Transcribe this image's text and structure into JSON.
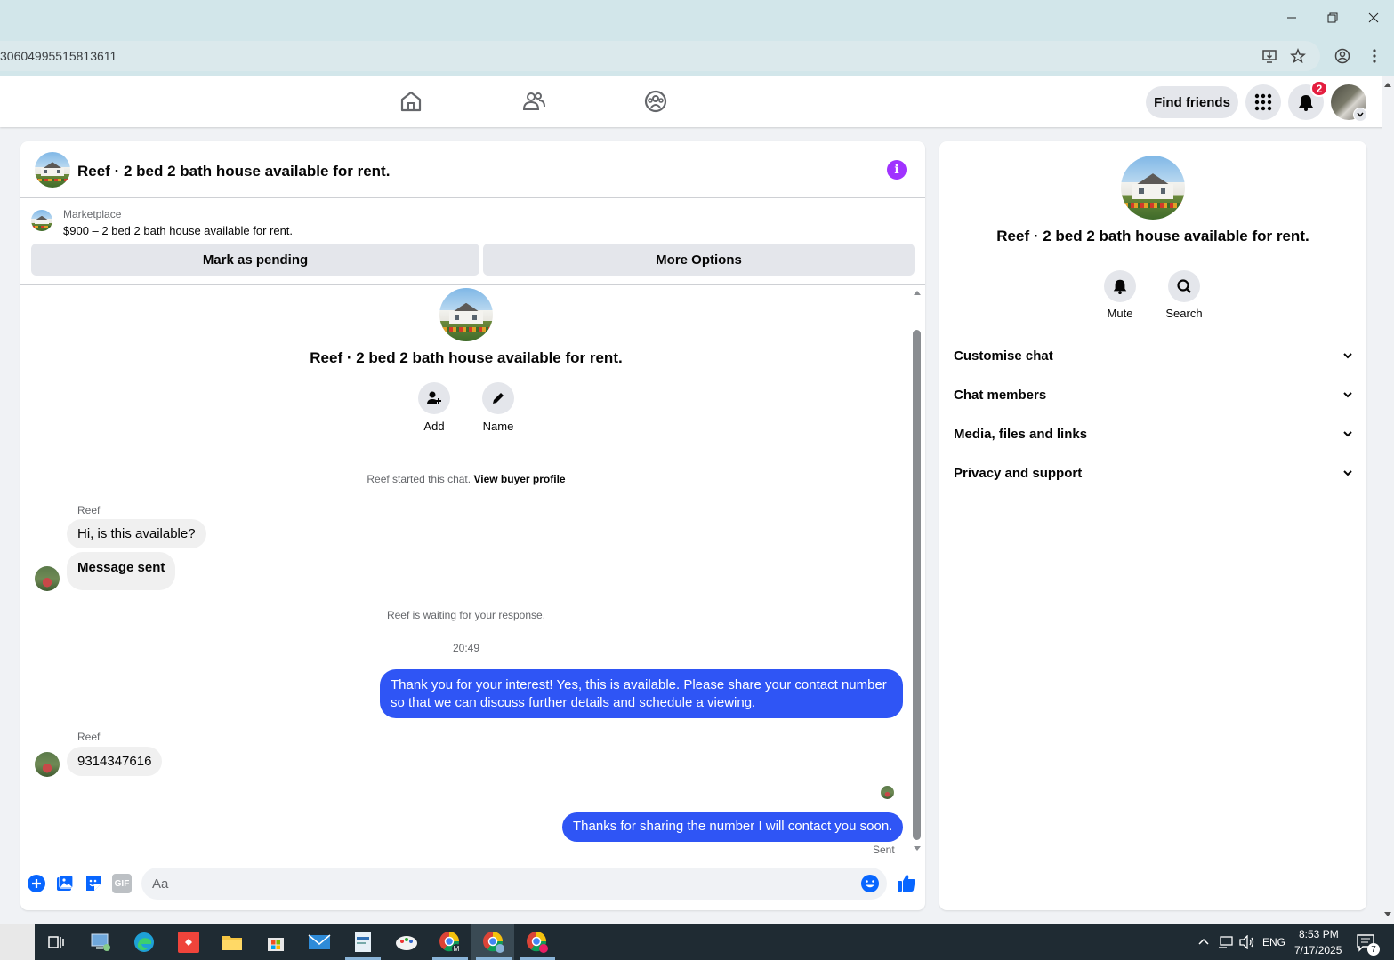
{
  "browser": {
    "url": "30604995515813611",
    "minimize_label": "—",
    "notification_count": "2"
  },
  "fbnav": {
    "find_friends": "Find friends"
  },
  "chat": {
    "title": "Reef · 2 bed 2 bath house available for rent.",
    "marketplace_label": "Marketplace",
    "listing": "$900 – 2 bed 2 bath house available for rent.",
    "mark_pending": "Mark as pending",
    "more_options": "More Options",
    "center_name": "Reef · 2 bed 2 bath house available for rent.",
    "add_label": "Add",
    "name_label": "Name",
    "started_text": "Reef started this chat.",
    "view_buyer_profile": "View buyer profile",
    "waiting_text": "Reef is waiting for your response.",
    "timestamp": "20:49",
    "sent_status": "Sent",
    "composer_placeholder": "Aa",
    "gif_label": "GIF",
    "messages": [
      {
        "sender": "Reef",
        "text": "Hi, is this available?"
      },
      {
        "text": "Message sent"
      },
      {
        "text": "Thank you for your interest! Yes, this is available. Please share your contact number so that we can discuss further details and schedule a viewing."
      },
      {
        "sender": "Reef",
        "text": "9314347616"
      },
      {
        "text": "Thanks for sharing the number I will contact you soon."
      }
    ]
  },
  "info_panel": {
    "name": "Reef · 2 bed 2 bath house available for rent.",
    "mute_label": "Mute",
    "search_label": "Search",
    "sections": [
      "Customise chat",
      "Chat members",
      "Media, files and links",
      "Privacy and support"
    ]
  },
  "taskbar": {
    "language": "ENG",
    "time": "8:53 PM",
    "date": "7/17/2025",
    "notif_count": "7"
  },
  "colors": {
    "accent_blue": "#2f55f5",
    "fb_blue": "#0866ff",
    "info_purple": "#a033ff",
    "badge_red": "#e41e3f"
  }
}
